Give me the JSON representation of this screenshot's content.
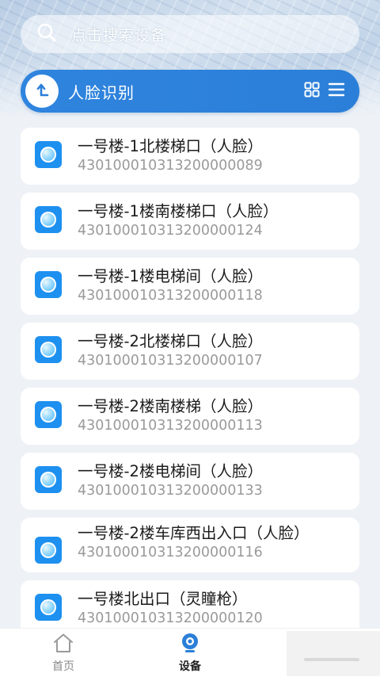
{
  "search": {
    "placeholder": "点击搜索设备"
  },
  "category": {
    "title": "人脸识别",
    "icons": [
      "back-up-icon",
      "grid-view-icon",
      "list-view-icon"
    ]
  },
  "devices": [
    {
      "name": "一号楼-1北楼梯口（人脸）",
      "code": "430100010313200000089"
    },
    {
      "name": "一号楼-1楼南楼梯口（人脸）",
      "code": "430100010313200000124"
    },
    {
      "name": "一号楼-1楼电梯间（人脸）",
      "code": "430100010313200000118"
    },
    {
      "name": "一号楼-2北楼梯口（人脸）",
      "code": "430100010313200000107"
    },
    {
      "name": "一号楼-2楼南楼梯（人脸）",
      "code": "430100010313200000113"
    },
    {
      "name": "一号楼-2楼电梯间（人脸）",
      "code": "430100010313200000133"
    },
    {
      "name": "一号楼-2楼车库西出入口（人脸）",
      "code": "430100010313200000116"
    },
    {
      "name": "一号楼北出口（灵瞳枪）",
      "code": "430100010313200000120"
    }
  ],
  "tabs": [
    {
      "label": "首页",
      "icon": "home-icon",
      "active": false
    },
    {
      "label": "设备",
      "icon": "camera-icon",
      "active": true
    }
  ],
  "colors": {
    "accent": "#2b7fd8",
    "device_icon": "#1e90f0",
    "code_text": "#9a9a9a"
  }
}
